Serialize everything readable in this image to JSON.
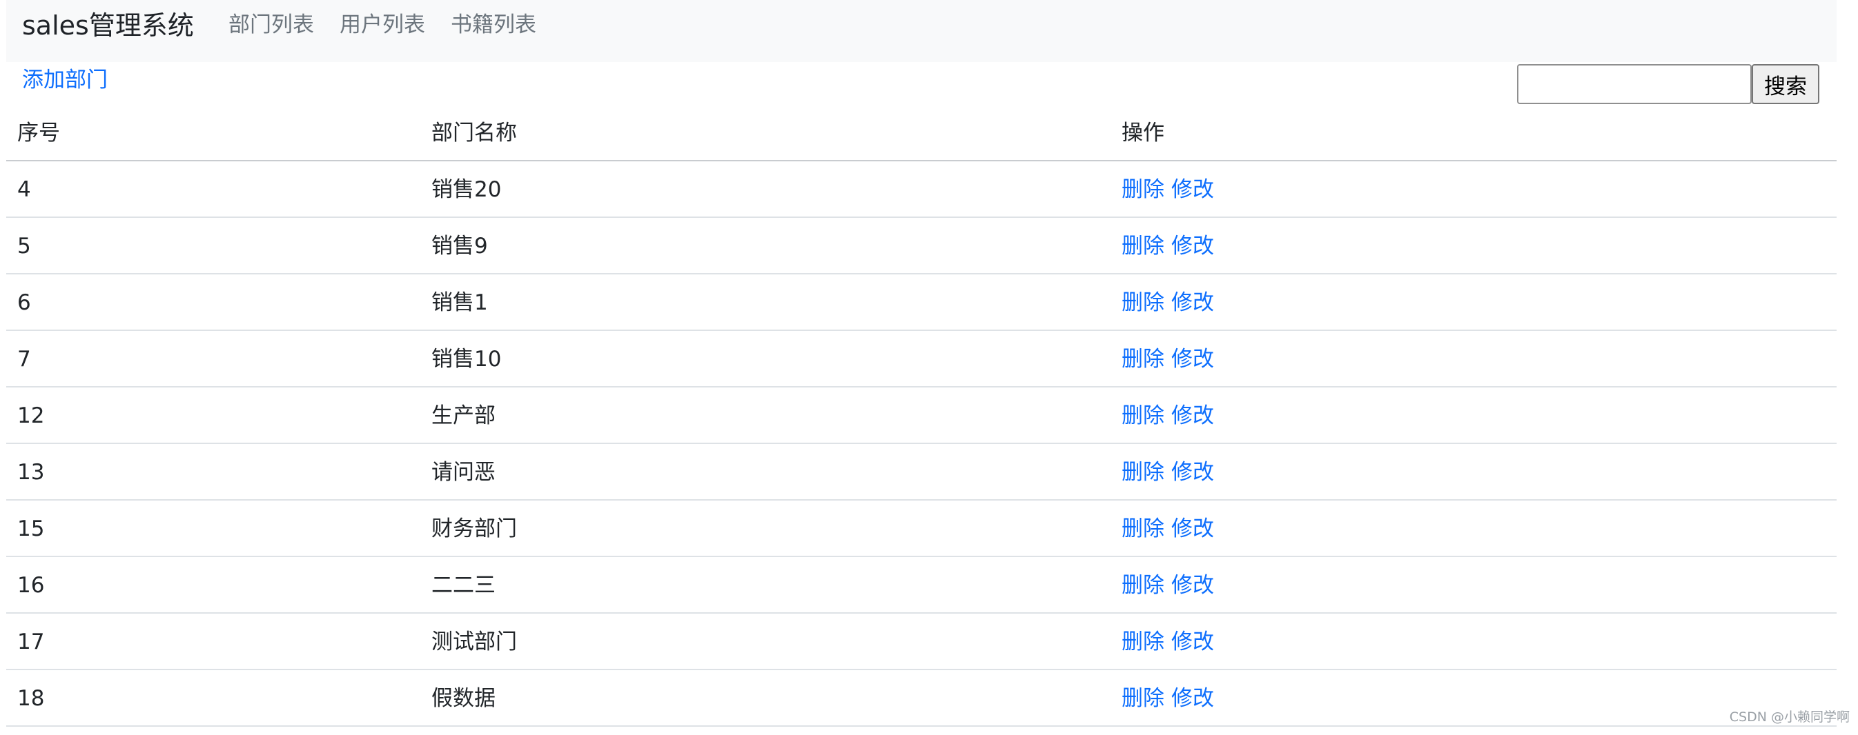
{
  "navbar": {
    "brand": "sales管理系统",
    "links": [
      "部门列表",
      "用户列表",
      "书籍列表"
    ]
  },
  "toolbar": {
    "add_label": "添加部门",
    "search_placeholder": "",
    "search_label": "搜索"
  },
  "table": {
    "headers": [
      "序号",
      "部门名称",
      "操作"
    ],
    "rows": [
      {
        "id": "4",
        "name": "销售20",
        "delete": "删除",
        "edit": "修改"
      },
      {
        "id": "5",
        "name": "销售9",
        "delete": "删除",
        "edit": "修改"
      },
      {
        "id": "6",
        "name": "销售1",
        "delete": "删除",
        "edit": "修改"
      },
      {
        "id": "7",
        "name": "销售10",
        "delete": "删除",
        "edit": "修改"
      },
      {
        "id": "12",
        "name": "生产部",
        "delete": "删除",
        "edit": "修改"
      },
      {
        "id": "13",
        "name": "请问恶",
        "delete": "删除",
        "edit": "修改"
      },
      {
        "id": "15",
        "name": "财务部门",
        "delete": "删除",
        "edit": "修改"
      },
      {
        "id": "16",
        "name": "二二三",
        "delete": "删除",
        "edit": "修改"
      },
      {
        "id": "17",
        "name": "测试部门",
        "delete": "删除",
        "edit": "修改"
      },
      {
        "id": "18",
        "name": "假数据",
        "delete": "删除",
        "edit": "修改"
      }
    ]
  },
  "watermark": "CSDN @小赖同学啊",
  "colors": {
    "link": "#0d6efd",
    "navbar_bg": "#f8f9fa",
    "nav_text": "#6c757d"
  }
}
